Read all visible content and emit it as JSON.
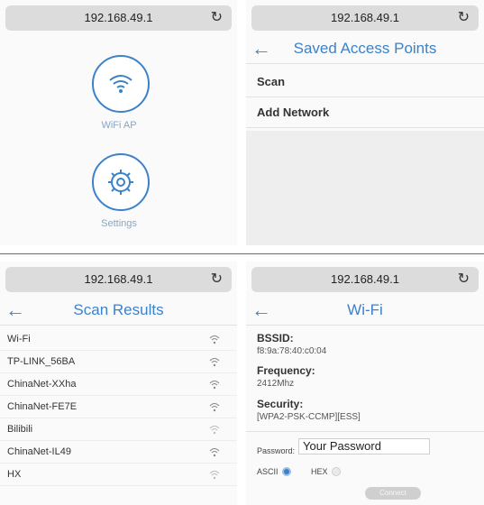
{
  "panel1": {
    "url": "192.168.49.1",
    "wifi_ap_label": "WiFi AP",
    "settings_label": "Settings"
  },
  "panel2": {
    "url": "192.168.49.1",
    "title": "Saved Access Points",
    "items": [
      "Scan",
      "Add Network"
    ]
  },
  "panel3": {
    "url": "192.168.49.1",
    "title": "Scan Results",
    "networks": [
      "Wi-Fi",
      "TP-LINK_56BA",
      "ChinaNet-XXha",
      "ChinaNet-FE7E",
      "Bilibili",
      "ChinaNet-IL49",
      "HX"
    ]
  },
  "panel4": {
    "url": "192.168.49.1",
    "title": "Wi-Fi",
    "bssid_label": "BSSID:",
    "bssid_value": "f8:9a:78:40:c0:04",
    "frequency_label": "Frequency:",
    "frequency_value": "2412Mhz",
    "security_label": "Security:",
    "security_value": "[WPA2-PSK-CCMP][ESS]",
    "password_label": "Password:",
    "password_placeholder": "Your Password",
    "ascii_label": "ASCII",
    "hex_label": "HEX",
    "connect_label": "Connect"
  },
  "colors": {
    "accent": "#3c82c8",
    "urlbar": "#dcdcdc",
    "divider": "#2e7bbf"
  },
  "icons": {
    "reload": "reload-icon",
    "back": "back-arrow-icon",
    "wifi": "wifi-icon",
    "settings": "gear-icon"
  }
}
